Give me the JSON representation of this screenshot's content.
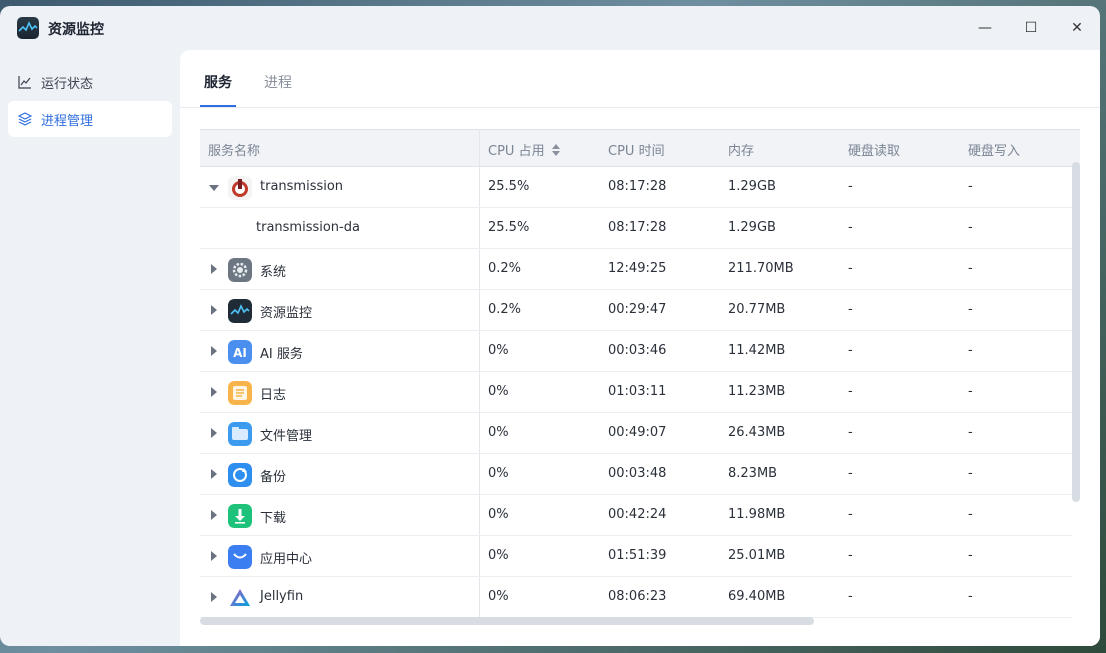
{
  "window": {
    "title": "资源监控",
    "controls": {
      "minimize": "—",
      "maximize": "☐",
      "close": "✕"
    }
  },
  "sidebar": {
    "items": [
      {
        "label": "运行状态",
        "icon": "line-chart-icon",
        "active": false
      },
      {
        "label": "进程管理",
        "icon": "layers-icon",
        "active": true
      }
    ]
  },
  "tabs": [
    {
      "label": "服务",
      "active": true
    },
    {
      "label": "进程",
      "active": false
    }
  ],
  "table": {
    "columns": [
      "服务名称",
      "CPU 占用",
      "CPU 时间",
      "内存",
      "硬盘读取",
      "硬盘写入"
    ],
    "sort_indicator": "sort-icon",
    "rows": [
      {
        "name": "transmission",
        "icon": "transmission-icon",
        "expanded": true,
        "cpu": "25.5%",
        "cpu_time": "08:17:28",
        "mem": "1.29GB",
        "disk_read": "-",
        "disk_write": "-"
      },
      {
        "name": "transmission-da",
        "icon": "",
        "child": true,
        "cpu": "25.5%",
        "cpu_time": "08:17:28",
        "mem": "1.29GB",
        "disk_read": "-",
        "disk_write": "-"
      },
      {
        "name": "系统",
        "icon": "gear-icon",
        "cpu": "0.2%",
        "cpu_time": "12:49:25",
        "mem": "211.70MB",
        "disk_read": "-",
        "disk_write": "-"
      },
      {
        "name": "资源监控",
        "icon": "resource-monitor-icon",
        "cpu": "0.2%",
        "cpu_time": "00:29:47",
        "mem": "20.77MB",
        "disk_read": "-",
        "disk_write": "-"
      },
      {
        "name": "AI 服务",
        "icon": "ai-icon",
        "cpu": "0%",
        "cpu_time": "00:03:46",
        "mem": "11.42MB",
        "disk_read": "-",
        "disk_write": "-"
      },
      {
        "name": "日志",
        "icon": "log-icon",
        "cpu": "0%",
        "cpu_time": "01:03:11",
        "mem": "11.23MB",
        "disk_read": "-",
        "disk_write": "-"
      },
      {
        "name": "文件管理",
        "icon": "folder-icon",
        "cpu": "0%",
        "cpu_time": "00:49:07",
        "mem": "26.43MB",
        "disk_read": "-",
        "disk_write": "-"
      },
      {
        "name": "备份",
        "icon": "backup-icon",
        "cpu": "0%",
        "cpu_time": "00:03:48",
        "mem": "8.23MB",
        "disk_read": "-",
        "disk_write": "-"
      },
      {
        "name": "下载",
        "icon": "download-icon",
        "cpu": "0%",
        "cpu_time": "00:42:24",
        "mem": "11.98MB",
        "disk_read": "-",
        "disk_write": "-"
      },
      {
        "name": "应用中心",
        "icon": "app-store-icon",
        "cpu": "0%",
        "cpu_time": "01:51:39",
        "mem": "25.01MB",
        "disk_read": "-",
        "disk_write": "-"
      },
      {
        "name": "Jellyfin",
        "icon": "jellyfin-icon",
        "cpu": "0%",
        "cpu_time": "08:06:23",
        "mem": "69.40MB",
        "disk_read": "-",
        "disk_write": "-"
      }
    ]
  },
  "colors": {
    "accent": "#2f6ee0",
    "sidebar_bg": "#eef1f5",
    "content_bg": "#ffffff"
  }
}
